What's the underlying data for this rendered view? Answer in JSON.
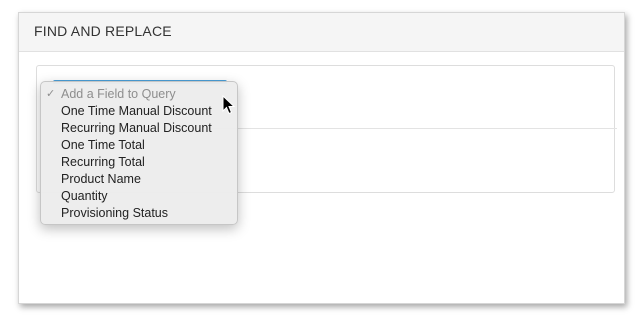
{
  "panel": {
    "title": "FIND AND REPLACE"
  },
  "dropdown": {
    "selected_label": "Add a Field to Query",
    "options": [
      "One Time Manual Discount",
      "Recurring Manual Discount",
      "One Time Total",
      "Recurring Total",
      "Product Name",
      "Quantity",
      "Provisioning Status"
    ]
  },
  "colors": {
    "accent": "#4a9fd8",
    "header_bg": "#f5f5f5",
    "menu_bg": "#ececec"
  },
  "icons": {
    "check": "checkmark-icon",
    "cursor": "mouse-pointer-icon"
  }
}
